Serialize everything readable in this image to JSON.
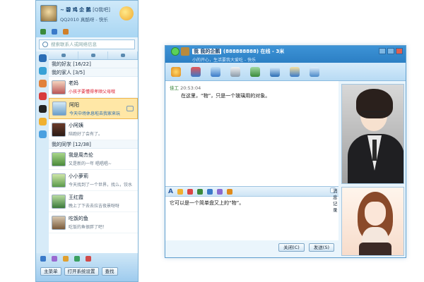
{
  "buddy": {
    "nickname": "~ 碧 鸡 企 鹅",
    "status": "[Q我吧]",
    "signature": "QQ2010 真酷呀 - 快乐",
    "search_placeholder": "搜索联系人或网络信息",
    "groups": [
      {
        "label": "我的好友 [16/22]"
      },
      {
        "label": "我的家人 [3/5]"
      },
      {
        "label": "我的同学 [12/38]"
      }
    ],
    "family": [
      {
        "name": "老妈",
        "sig": "小孩子要懂得孝顺父母哦",
        "sig_style": "red"
      },
      {
        "name": "阿阳",
        "sig": "今天中场休息啦去我家来玩",
        "sig_style": "blue"
      },
      {
        "name": "小阿姨",
        "sig": "陪跑好了会有了。",
        "sig_style": ""
      }
    ],
    "classmates": [
      {
        "name": "我是周杰伦",
        "sig": "又是新的一年 唱唱唱~",
        "sig_style": ""
      },
      {
        "name": "小小萝莉",
        "sig": "今天找到了一个世界，找么，饺水",
        "sig_style": ""
      },
      {
        "name": "王红霞",
        "sig": "晚上了下去去拉吉夜景呀呀",
        "sig_style": ""
      },
      {
        "name": "吃饭的鱼",
        "sig": "吃饭的鱼很胖了吧！",
        "sig_style": ""
      }
    ],
    "footer_buttons": [
      "主菜单",
      "打开系统设置",
      "查找"
    ],
    "colors": {
      "frame": "#7fb3d6",
      "selected": "#ffe7a6"
    }
  },
  "chat": {
    "title_name": "我 我的企鹅",
    "title_qq": "(888888888)",
    "title_status": "在线 - 3米",
    "title_signature": "小的开心，生活要我大爱吃 - 快乐",
    "messages": [
      {
        "sender": "佳工",
        "time": "20:53:04",
        "text": "在这里，“物”，只是一个玻璃用的对象。"
      }
    ],
    "input_text": "它可以是一个简单盘又上的“物”。",
    "history_label": "消息记录",
    "close_label": "关闭(C)",
    "send_label": "发送(S)"
  }
}
